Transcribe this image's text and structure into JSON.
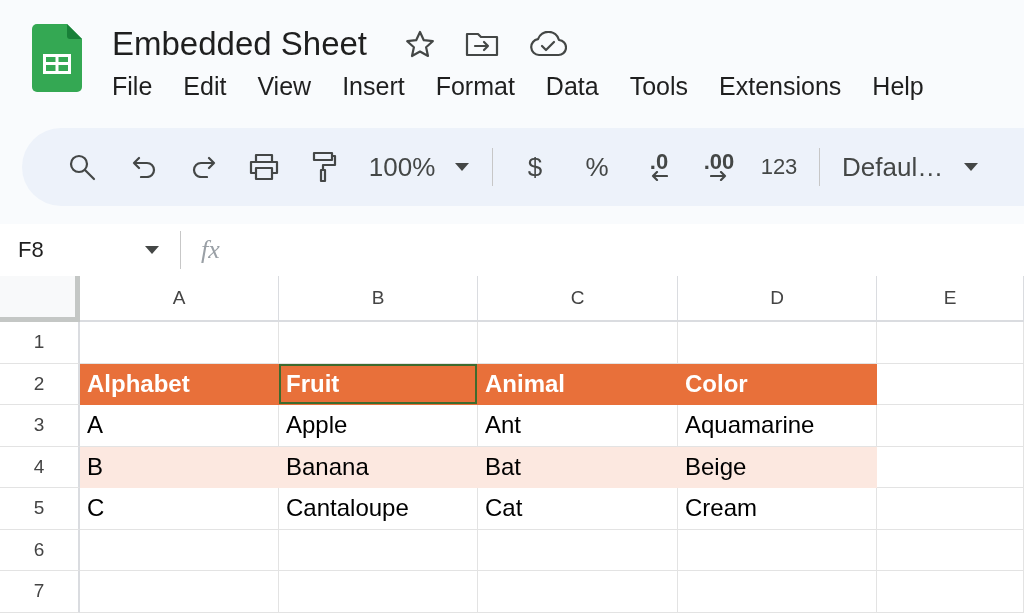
{
  "document": {
    "title": "Embedded Sheet"
  },
  "menu": [
    "File",
    "Edit",
    "View",
    "Insert",
    "Format",
    "Data",
    "Tools",
    "Extensions",
    "Help"
  ],
  "toolbar": {
    "zoom": "100%",
    "currency": "$",
    "percent": "%",
    "decrease_decimals": ".0",
    "increase_decimals": ".00",
    "more_formats": "123",
    "font": "Defaul…"
  },
  "name_box": "F8",
  "formula_label": "fx",
  "columns": [
    "A",
    "B",
    "C",
    "D",
    "E"
  ],
  "rows": [
    {
      "number": "1",
      "kind": "plain"
    },
    {
      "number": "2",
      "kind": "header",
      "cells": [
        {
          "text": "Alphabet",
          "selected": false
        },
        {
          "text": "Fruit",
          "selected": true
        },
        {
          "text": "Animal",
          "selected": false
        },
        {
          "text": "Color",
          "selected": false
        }
      ]
    },
    {
      "number": "3",
      "kind": "plain",
      "cells": [
        {
          "text": "A",
          "selected": false
        },
        {
          "text": "Apple",
          "selected": false
        },
        {
          "text": "Ant",
          "selected": false
        },
        {
          "text": "Aquamarine",
          "selected": false
        }
      ]
    },
    {
      "number": "4",
      "kind": "banded",
      "cells": [
        {
          "text": "B",
          "selected": false
        },
        {
          "text": "Banana",
          "selected": false
        },
        {
          "text": "Bat",
          "selected": false
        },
        {
          "text": "Beige",
          "selected": false
        }
      ]
    },
    {
      "number": "5",
      "kind": "plain",
      "cells": [
        {
          "text": "C",
          "selected": false
        },
        {
          "text": "Cantaloupe",
          "selected": false
        },
        {
          "text": "Cat",
          "selected": false
        },
        {
          "text": "Cream",
          "selected": false
        }
      ]
    },
    {
      "number": "6",
      "kind": "plain"
    },
    {
      "number": "7",
      "kind": "plain"
    }
  ]
}
